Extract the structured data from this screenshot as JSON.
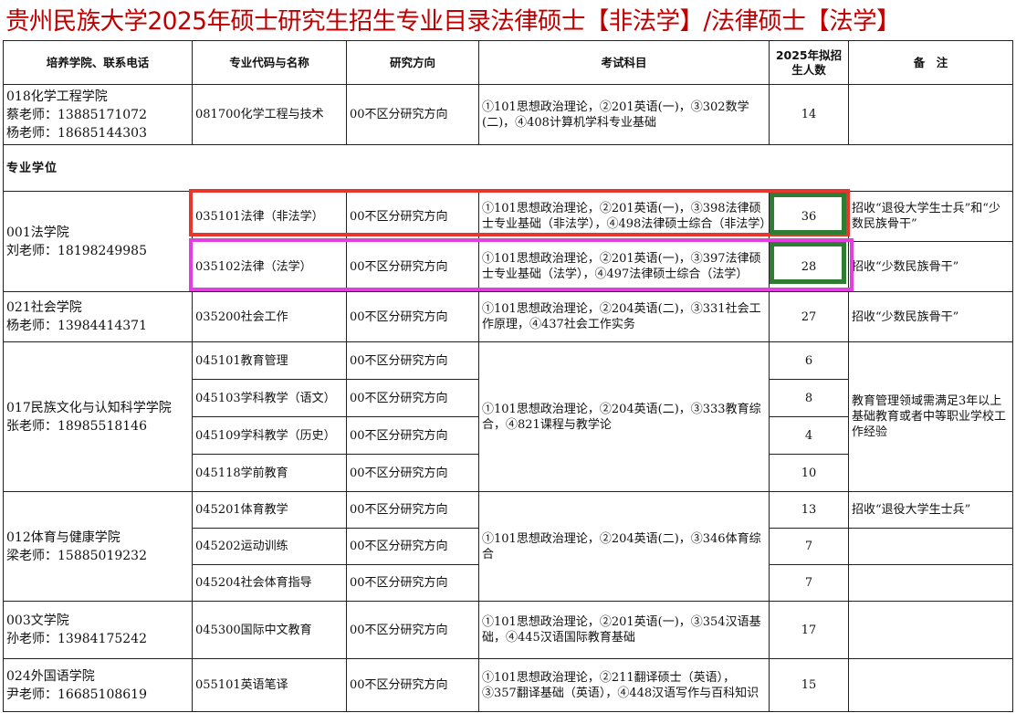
{
  "title": "贵州民族大学2025年硕士研究生招生专业目录法律硕士【非法学】/法律硕士【法学】",
  "headers": {
    "college": "培养学院、联系电话",
    "major": "专业代码与名称",
    "direction": "研究方向",
    "exam": "考试科目",
    "plan": "2025年拟招生人数",
    "note": "备　注"
  },
  "rows": {
    "r1": {
      "college": [
        "018化学工程学院",
        "蔡老师：13885171072",
        "杨老师：18685144303"
      ],
      "major": "081700化学工程与技术",
      "direction": "00不区分研究方向",
      "exam": "①101思想政治理论，②201英语(一)，③302数学(二)，④408计算机学科专业基础",
      "plan": "14",
      "note": ""
    },
    "section": "专业学位",
    "g_law": {
      "college": [
        "001法学院",
        "刘老师：18198249985"
      ],
      "rows": [
        {
          "major": "035101法律（非法学）",
          "direction": "00不区分研究方向",
          "exam": "①101思想政治理论，②201英语(一)，③398法律硕士专业基础（非法学），④498法律硕士综合（非法学）",
          "plan": "36",
          "note": "招收“退役大学生士兵”和“少数民族骨干”"
        },
        {
          "major": "035102法律（法学）",
          "direction": "00不区分研究方向",
          "exam": "①101思想政治理论，②201英语(一)，③397法律硕士专业基础（法学），④497法律硕士综合（法学）",
          "plan": "28",
          "note": "招收“少数民族骨干”"
        }
      ]
    },
    "r_social": {
      "college": [
        "021社会学院",
        "杨老师：13984414371"
      ],
      "major": "035200社会工作",
      "direction": "00不区分研究方向",
      "exam": "①101思想政治理论，②204英语(二)，③331社会工作原理，④437社会工作实务",
      "plan": "27",
      "note": "招收“少数民族骨干”"
    },
    "g_edu": {
      "college": [
        "017民族文化与认知科学学院",
        "张老师：18985518146"
      ],
      "exam": "①101思想政治理论，②204英语(二)，③333教育综合，④821课程与教学论",
      "note": "教育管理领域需满足3年以上基础教育或者中等职业学校工作经验",
      "rows": [
        {
          "major": "045101教育管理",
          "direction": "00不区分研究方向",
          "plan": "6"
        },
        {
          "major": "045103学科教学（语文）",
          "direction": "00不区分研究方向",
          "plan": "8"
        },
        {
          "major": "045109学科教学（历史）",
          "direction": "00不区分研究方向",
          "plan": "4"
        },
        {
          "major": "045118学前教育",
          "direction": "00不区分研究方向",
          "plan": "10"
        }
      ]
    },
    "g_pe": {
      "college": [
        "012体育与健康学院",
        "梁老师：15885019232"
      ],
      "exam": "①101思想政治理论，②204英语(二)，③346体育综合",
      "rows": [
        {
          "major": "045201体育教学",
          "direction": "00不区分研究方向",
          "plan": "13",
          "note": "招收“退役大学生士兵”"
        },
        {
          "major": "045202运动训练",
          "direction": "00不区分研究方向",
          "plan": "7",
          "note": ""
        },
        {
          "major": "045204社会体育指导",
          "direction": "00不区分研究方向",
          "plan": "7",
          "note": ""
        }
      ]
    },
    "r_lit": {
      "college": [
        "003文学院",
        "孙老师：13984175242"
      ],
      "major": "045300国际中文教育",
      "direction": "00不区分研究方向",
      "exam": "①101思想政治理论，②201英语(一)，③354汉语基础，④445汉语国际教育基础",
      "plan": "17",
      "note": ""
    },
    "r_lang": {
      "college": [
        "024外国语学院",
        "尹老师：16685108619"
      ],
      "major": "055101英语笔译",
      "direction": "00不区分研究方向",
      "exam": "①101思想政治理论，②211翻译硕士（英语），③357翻译基础（英语），④448汉语写作与百科知识",
      "plan": "15",
      "note": ""
    }
  },
  "highlights": {
    "red": "#e8352d",
    "magenta": "#e23ee0",
    "green": "#2e7d32"
  }
}
